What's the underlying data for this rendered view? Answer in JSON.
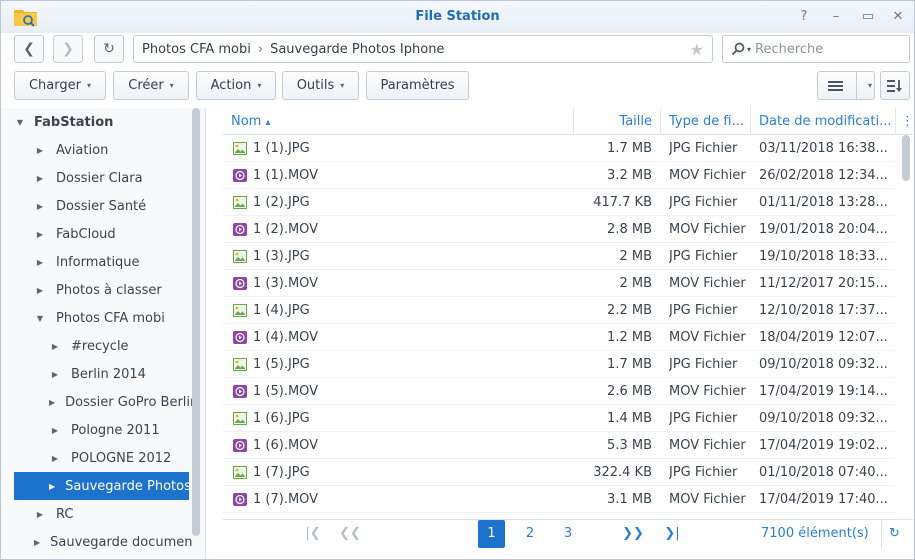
{
  "window": {
    "title": "File Station",
    "controls": [
      "?",
      "–",
      "▭",
      "✕"
    ]
  },
  "nav": {
    "back": "❮",
    "forward": "❯",
    "refresh": "↻",
    "path": [
      "Photos CFA mobi",
      "Sauvegarde Photos Iphone"
    ],
    "path_sep": "›",
    "star": "★",
    "search_placeholder": "Recherche",
    "search_caret": "▾"
  },
  "toolbar": {
    "buttons": [
      "Charger",
      "Créer",
      "Action",
      "Outils",
      "Paramètres"
    ],
    "caret": "▾"
  },
  "sidebar": {
    "root": "FabStation",
    "items": [
      {
        "label": "Aviation",
        "level": 1,
        "expanded": false
      },
      {
        "label": "Dossier Clara",
        "level": 1,
        "expanded": false
      },
      {
        "label": "Dossier Santé",
        "level": 1,
        "expanded": false
      },
      {
        "label": "FabCloud",
        "level": 1,
        "expanded": false
      },
      {
        "label": "Informatique",
        "level": 1,
        "expanded": false
      },
      {
        "label": "Photos à classer",
        "level": 1,
        "expanded": false
      },
      {
        "label": "Photos CFA mobi",
        "level": 1,
        "expanded": true
      },
      {
        "label": "#recycle",
        "level": 2,
        "expanded": false
      },
      {
        "label": "Berlin 2014",
        "level": 2,
        "expanded": false
      },
      {
        "label": "Dossier GoPro Berlin",
        "level": 2,
        "expanded": false
      },
      {
        "label": "Pologne 2011",
        "level": 2,
        "expanded": false
      },
      {
        "label": "POLOGNE 2012",
        "level": 2,
        "expanded": false
      },
      {
        "label": "Sauvegarde Photos",
        "level": 2,
        "expanded": false,
        "selected": true
      },
      {
        "label": "RC",
        "level": 1,
        "expanded": false
      },
      {
        "label": "Sauvegarde document",
        "level": 1,
        "expanded": false
      }
    ]
  },
  "table": {
    "columns": {
      "name": "Nom",
      "size": "Taille",
      "type": "Type de fi...",
      "date": "Date de modificati..."
    },
    "sort_indicator": "▴",
    "menu_icon": "⋮",
    "rows": [
      {
        "name": "1 (1).JPG",
        "size": "1.7 MB",
        "type": "JPG Fichier",
        "date": "03/11/2018 16:38...",
        "kind": "image"
      },
      {
        "name": "1 (1).MOV",
        "size": "3.2 MB",
        "type": "MOV Fichier",
        "date": "26/02/2018 12:34...",
        "kind": "video"
      },
      {
        "name": "1 (2).JPG",
        "size": "417.7 KB",
        "type": "JPG Fichier",
        "date": "01/11/2018 13:28...",
        "kind": "image"
      },
      {
        "name": "1 (2).MOV",
        "size": "2.8 MB",
        "type": "MOV Fichier",
        "date": "19/01/2018 20:04...",
        "kind": "video"
      },
      {
        "name": "1 (3).JPG",
        "size": "2 MB",
        "type": "JPG Fichier",
        "date": "19/10/2018 18:33...",
        "kind": "image"
      },
      {
        "name": "1 (3).MOV",
        "size": "2 MB",
        "type": "MOV Fichier",
        "date": "11/12/2017 20:15...",
        "kind": "video"
      },
      {
        "name": "1 (4).JPG",
        "size": "2.2 MB",
        "type": "JPG Fichier",
        "date": "12/10/2018 17:37...",
        "kind": "image"
      },
      {
        "name": "1 (4).MOV",
        "size": "1.2 MB",
        "type": "MOV Fichier",
        "date": "18/04/2019 12:07...",
        "kind": "video"
      },
      {
        "name": "1 (5).JPG",
        "size": "1.7 MB",
        "type": "JPG Fichier",
        "date": "09/10/2018 09:32...",
        "kind": "image"
      },
      {
        "name": "1 (5).MOV",
        "size": "2.6 MB",
        "type": "MOV Fichier",
        "date": "17/04/2019 19:14...",
        "kind": "video"
      },
      {
        "name": "1 (6).JPG",
        "size": "1.4 MB",
        "type": "JPG Fichier",
        "date": "09/10/2018 09:32...",
        "kind": "image"
      },
      {
        "name": "1 (6).MOV",
        "size": "5.3 MB",
        "type": "MOV Fichier",
        "date": "17/04/2019 19:02...",
        "kind": "video"
      },
      {
        "name": "1 (7).JPG",
        "size": "322.4 KB",
        "type": "JPG Fichier",
        "date": "01/10/2018 07:40...",
        "kind": "image"
      },
      {
        "name": "1 (7).MOV",
        "size": "3.1 MB",
        "type": "MOV Fichier",
        "date": "17/04/2019 17:40...",
        "kind": "video"
      }
    ]
  },
  "pagination": {
    "first": "|❮",
    "prev": "❮❮",
    "pages": [
      "1",
      "2",
      "3"
    ],
    "current": "1",
    "next": "❯❯",
    "last": "❯|",
    "count": "7100 élément(s)",
    "refresh": "↻"
  },
  "colors": {
    "accent": "#1d73cc",
    "title": "#1f6bb8",
    "link": "#2a7fd4",
    "image_icon": "#6aa84f",
    "video_icon": "#8e44ad"
  }
}
